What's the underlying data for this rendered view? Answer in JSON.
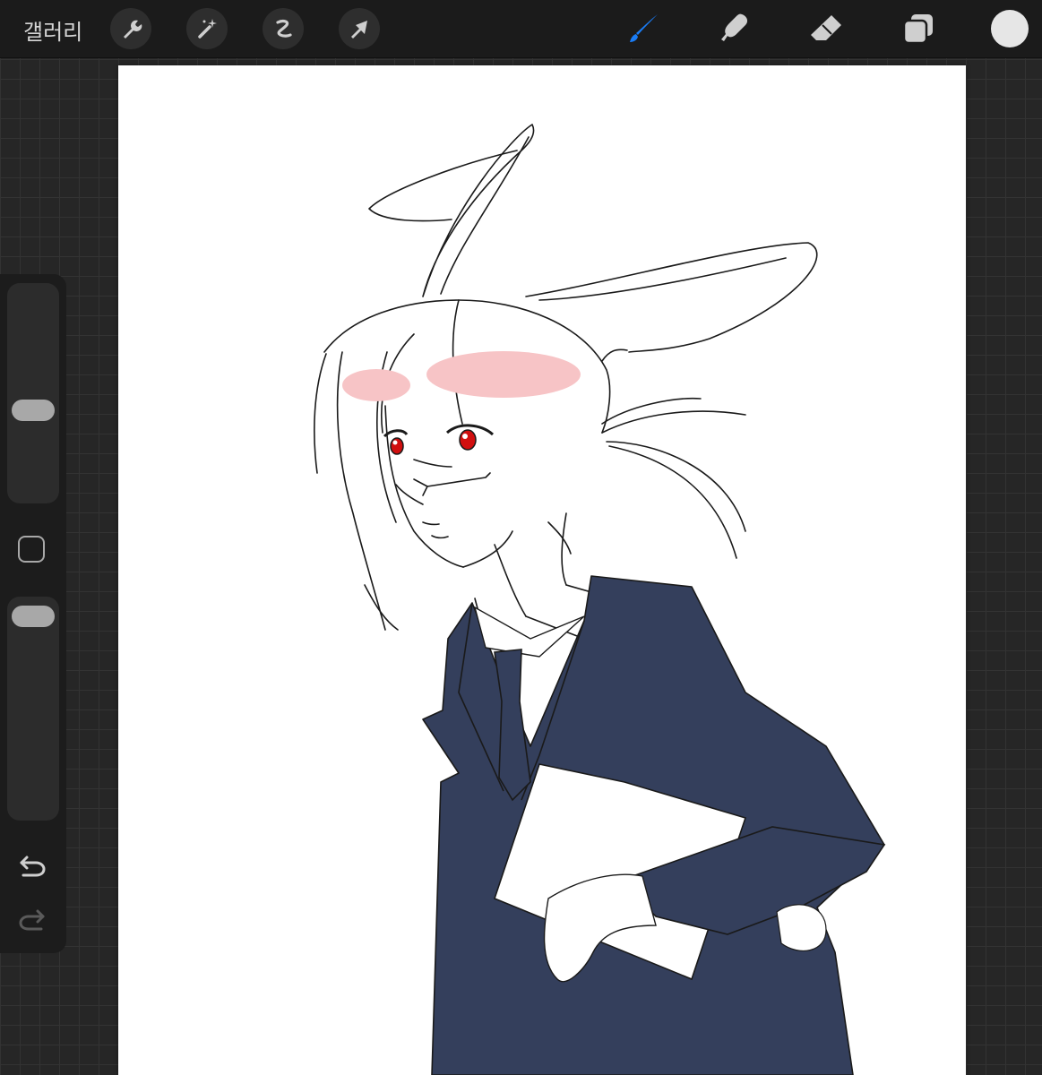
{
  "topbar": {
    "gallery_label": "갤러리",
    "left_tools": [
      "wrench-icon",
      "magic-wand-icon",
      "selection-icon",
      "transform-arrow-icon"
    ],
    "right_tools": [
      "brush-icon",
      "smudge-icon",
      "eraser-icon",
      "layers-icon"
    ],
    "active_tool": "brush",
    "active_color": "#1a7cf5",
    "current_color": "#e6e6e6"
  },
  "sidebar": {
    "brush_size_level": 0.55,
    "opacity_level": 1.0,
    "controls": [
      "brush-size-slider",
      "modify-button",
      "opacity-slider",
      "undo-icon",
      "redo-icon"
    ]
  },
  "canvas": {
    "background": "#ffffff",
    "suit_color": "#343f5c",
    "eye_color": "#d10f0f",
    "blush_color": "#f7c4c6"
  }
}
